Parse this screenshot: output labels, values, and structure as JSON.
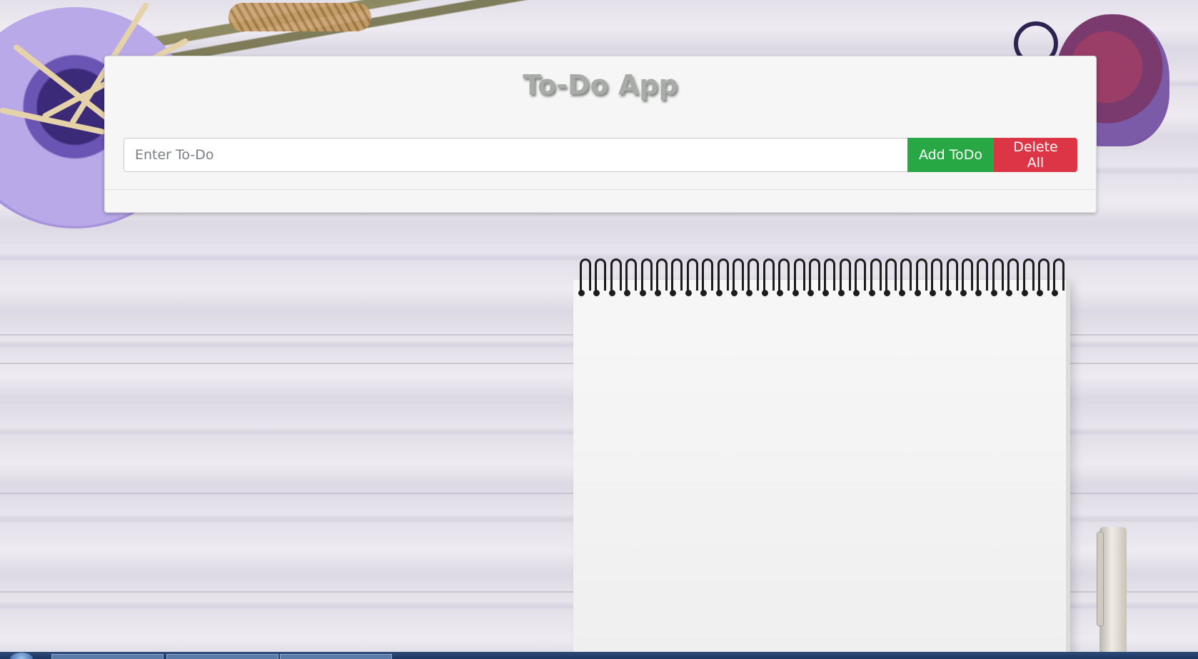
{
  "app": {
    "title": "To-Do App"
  },
  "form": {
    "input_placeholder": "Enter To-Do",
    "input_value": "",
    "add_label": "Add ToDo",
    "delete_all_label": "Delete All"
  },
  "todos": [],
  "colors": {
    "add_button": "#28a745",
    "delete_button": "#dc3545",
    "card_background": "#f6f6f6",
    "title_text": "#a8aba8"
  },
  "decor": {
    "vase_icon": "vase-icon",
    "candle_icon": "candle-icon",
    "notebook_icon": "notebook-icon",
    "pen_icon": "pen-icon"
  }
}
